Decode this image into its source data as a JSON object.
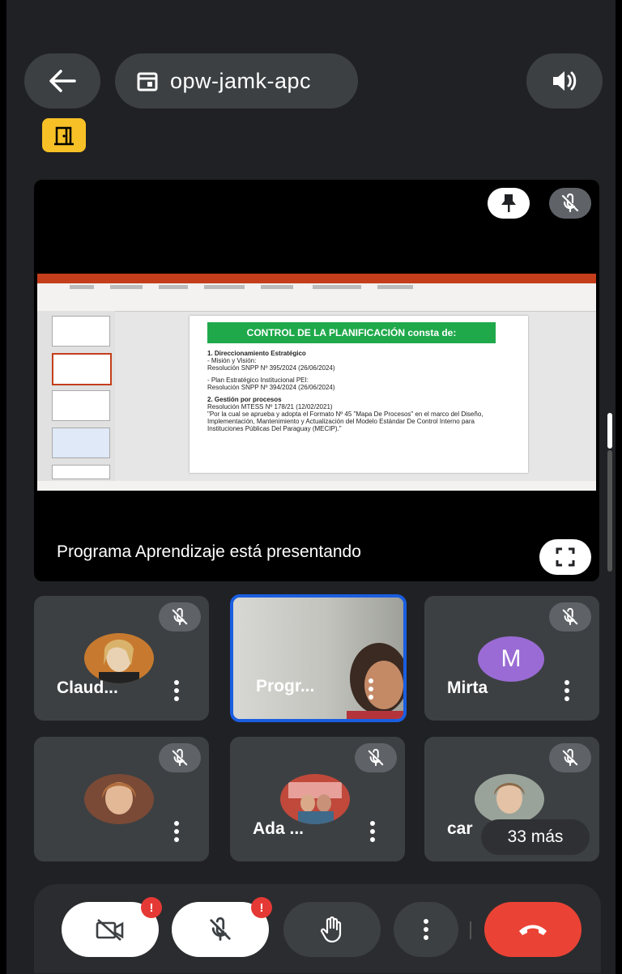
{
  "header": {
    "meeting_code": "opw-jamk-apc"
  },
  "stage": {
    "presenting_text": "Programa Aprendizaje está presentando",
    "slide": {
      "title": "CONTROL DE LA PLANIFICACIÓN consta de:",
      "lines": [
        "1. Direccionamiento Estratégico",
        "- Misión y Visión:",
        "Resolución SNPP Nº 395/2024 (26/06/2024)",
        "- Plan Estratégico Institucional PEI:",
        "Resolución SNPP Nº 394/2024 (26/06/2024)",
        "2. Gestión por procesos",
        "Resolución MTESS Nº 178/21 (12/02/2021)",
        "\"Por la cual se aprueba y adopta el Formato Nº 45 \"Mapa De Procesos\" en el marco del Diseño, Implementación, Mantenimiento y Actualización del Modelo Estándar De Control Interno para Instituciones Públicas Del Paraguay (MECIP).\""
      ]
    }
  },
  "participants": [
    {
      "name": "Claud..."
    },
    {
      "name": "Progr..."
    },
    {
      "name": "Mirta",
      "initial": "M"
    },
    {
      "name": ""
    },
    {
      "name": "Ada ..."
    },
    {
      "name": "car"
    }
  ],
  "more_count_label": "33 más",
  "controls": {
    "camera_alert": "!",
    "mic_alert": "!"
  },
  "colors": {
    "accent_blue": "#1a5ee0",
    "hangup_red": "#ea4335",
    "avatar_purple": "#9a6bd4",
    "badge_yellow": "#f6c026",
    "slide_green": "#1fa94b"
  }
}
